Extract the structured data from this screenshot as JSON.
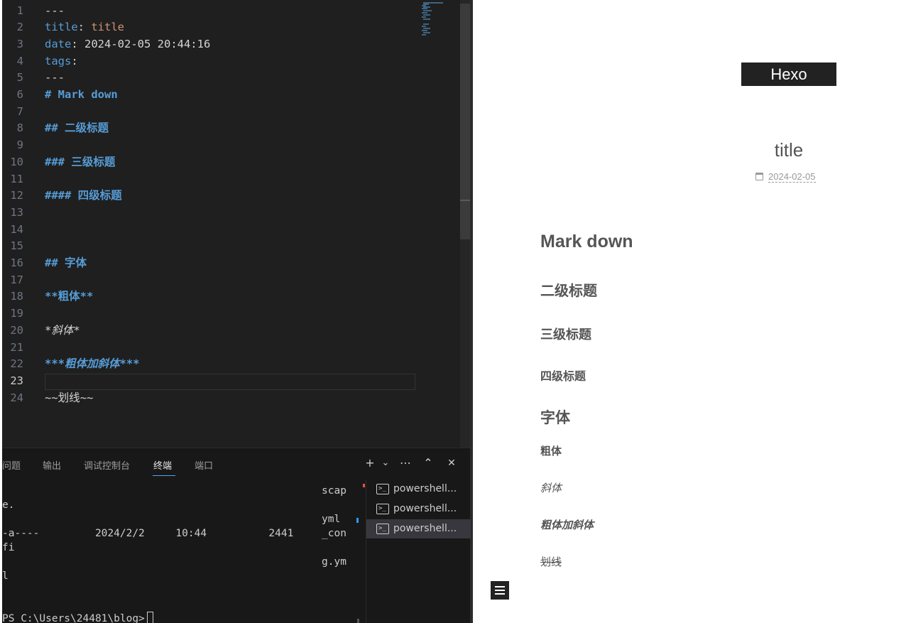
{
  "editor": {
    "lines": [
      {
        "n": "1",
        "text": "---"
      },
      {
        "n": "2",
        "key": "title",
        "colon": ": ",
        "value": "title"
      },
      {
        "n": "3",
        "key": "date",
        "colon": ": ",
        "value": "2024-02-05 20:44:16"
      },
      {
        "n": "4",
        "key": "tags",
        "colon": ":"
      },
      {
        "n": "5",
        "text": "---"
      },
      {
        "n": "6",
        "heading": "# Mark down"
      },
      {
        "n": "7"
      },
      {
        "n": "8",
        "heading": "## 二级标题"
      },
      {
        "n": "9"
      },
      {
        "n": "10",
        "heading": "### 三级标题"
      },
      {
        "n": "11"
      },
      {
        "n": "12",
        "heading": "#### 四级标题"
      },
      {
        "n": "13"
      },
      {
        "n": "14"
      },
      {
        "n": "15"
      },
      {
        "n": "16",
        "heading": "## 字体"
      },
      {
        "n": "17"
      },
      {
        "n": "18",
        "bold": "**粗体**"
      },
      {
        "n": "19"
      },
      {
        "n": "20",
        "italic": "*斜体*"
      },
      {
        "n": "21"
      },
      {
        "n": "22",
        "bi_mark_open": "***",
        "bi_text": "粗体加斜体",
        "bi_mark_close": "***"
      },
      {
        "n": "23"
      },
      {
        "n": "24",
        "strike_open": "~~",
        "strike_text": "划线",
        "strike_close": "~~"
      }
    ],
    "active_line": "23"
  },
  "panel": {
    "tabs": [
      "问题",
      "输出",
      "调试控制台",
      "终端",
      "端口"
    ],
    "active_tab": "终端",
    "actions": {
      "add": "+",
      "dropdown": "⌄",
      "more": "⋯",
      "maximize": "⌃",
      "close": "✕"
    }
  },
  "terminal": {
    "lines": {
      "l1": "scap",
      "l2": "e.",
      "l3": "yml",
      "l4a": "-a----         2024/2/2     10:44          2441",
      "l4b": "_con",
      "l5": "fi",
      "l6": "g.ym",
      "l7": "l",
      "prompt": "PS C:\\Users\\24481\\blog>"
    },
    "sessions": [
      "powershell...",
      "powershell...",
      "powershell..."
    ],
    "selected_session": 2
  },
  "preview": {
    "brand": "Hexo",
    "post_title": "title",
    "post_date": "2024-02-05",
    "headings": {
      "h1": "Mark down",
      "h2": "二级标题",
      "h3": "三级标题",
      "h4": "四级标题",
      "h5": "字体"
    },
    "bold": "粗体",
    "italic": "斜体",
    "bold_italic": "粗体加斜体",
    "strike": "划线"
  },
  "colors": {
    "editor_bg": "#1f1f1f",
    "keyword_blue": "#569cd6",
    "string_orange": "#ce9178",
    "brand_bg": "#222222"
  }
}
